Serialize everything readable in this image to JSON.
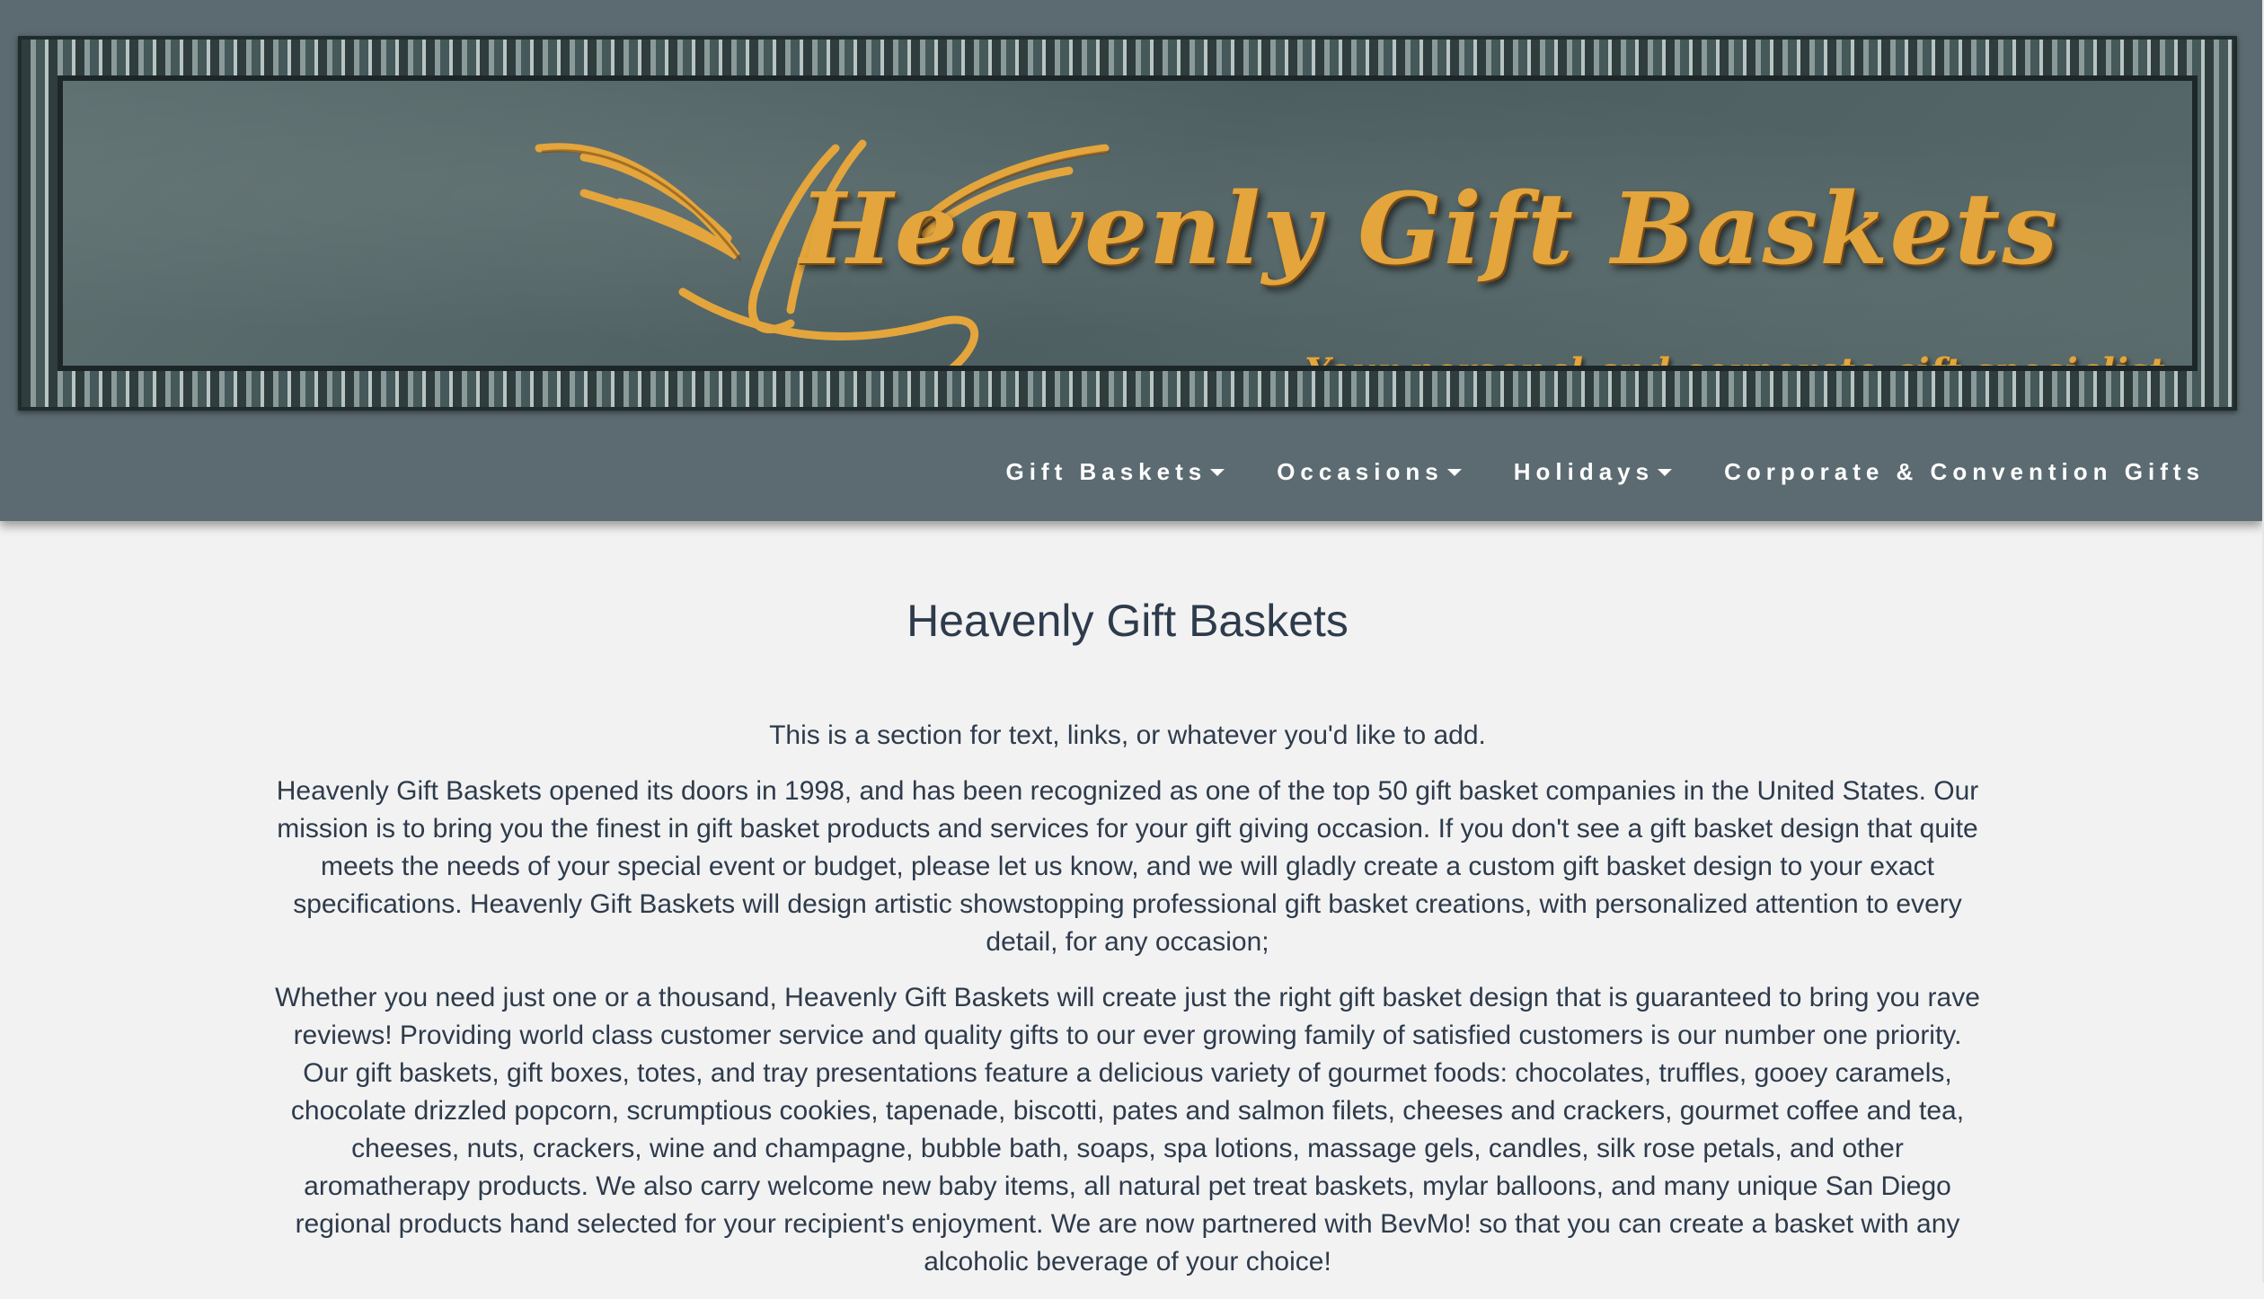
{
  "banner": {
    "logo_title": "Heavenly Gift Baskets",
    "logo_tagline": "Your personal and corporate gift specialist"
  },
  "nav": {
    "items": [
      {
        "label": "Gift Baskets",
        "icon": "caret-down-icon"
      },
      {
        "label": "Occasions",
        "icon": "caret-down-icon"
      },
      {
        "label": "Holidays",
        "icon": "caret-down-icon"
      },
      {
        "label": "Corporate & Convention Gifts"
      }
    ]
  },
  "main": {
    "title": "Heavenly Gift Baskets",
    "intro": "This is a section for text, links, or whatever you'd like to add.",
    "paragraph1": "Heavenly Gift Baskets opened its doors in 1998, and has been recognized as one of the top 50 gift basket companies in the United States. Our mission is to bring you the finest in gift basket products and services for your gift giving occasion. If you don't see a gift basket design that quite meets the needs of your special event or budget, please let us know, and we will gladly create a custom gift basket design to your exact specifications. Heavenly Gift Baskets will design artistic showstopping professional gift basket creations, with personalized attention to every detail, for any occasion;",
    "paragraph2": "Whether you need just one or a thousand, Heavenly Gift Baskets will create just the right gift basket design that is guaranteed to bring you rave reviews! Providing world class customer service and quality gifts to our ever growing family of satisfied customers is our number one priority. Our gift baskets, gift boxes, totes, and tray presentations feature a delicious variety of gourmet foods: chocolates, truffles, gooey caramels, chocolate drizzled popcorn, scrumptious cookies, tapenade, biscotti, pates and salmon filets, cheeses and crackers, gourmet coffee and tea, cheeses, nuts, crackers, wine and champagne, bubble bath, soaps, spa lotions, massage gels, candles, silk rose petals, and other aromatherapy products. We also carry welcome new baby items, all natural pet treat baskets, mylar balloons, and many unique San Diego regional products hand selected for your recipient's enjoyment. We are now partnered with BevMo! so that you can create a basket with any alcoholic beverage of your choice!"
  },
  "colors": {
    "header_bg": "#5c6b72",
    "page_bg": "#f2f2f2",
    "gold": "#e3a53c",
    "text": "#2e3b4c"
  }
}
